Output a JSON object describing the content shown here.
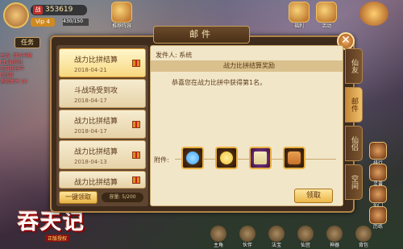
{
  "hud": {
    "power_label": "战",
    "power": "353619",
    "vip": "Vip 4",
    "exp": "430/150",
    "top_icons": [
      "推荐阵容",
      "福利",
      "活动"
    ],
    "quest_btn": "任务",
    "quest_lines": [
      "主线: 拜访神秘",
      "[主线]前往",
      "在百花谷中",
      "[完成]",
      "消耗体力 10"
    ],
    "logo_main": "吞天记",
    "logo_sub": "正版授权"
  },
  "bottom_bar": [
    "主角",
    "伙伴",
    "法宝",
    "仙宫",
    "神器",
    "背包"
  ],
  "side_menu": [
    "排行",
    "灵兽",
    "仙门",
    "历练"
  ],
  "mail": {
    "title": "邮件",
    "close_icon": "close-icon",
    "list": [
      {
        "title": "战力比拼结算",
        "date": "2018-04-21",
        "gift": true,
        "active": true
      },
      {
        "title": "斗战场受到攻",
        "date": "2018-04-17",
        "gift": false,
        "active": false
      },
      {
        "title": "战力比拼结算",
        "date": "2018-04-17",
        "gift": true,
        "active": false
      },
      {
        "title": "战力比拼结算",
        "date": "2018-04-13",
        "gift": true,
        "active": false
      },
      {
        "title": "战力比拼结算",
        "date": "2018-04-",
        "gift": true,
        "active": false
      }
    ],
    "one_key_receive": "一键领取",
    "capacity": "容量: 5/200",
    "sender": "发件人: 系统",
    "subject": "战力比拼结算奖励",
    "body": "恭喜您在战力比拼中获得第1名。",
    "attachments_label": "附件:",
    "attachments": [
      {
        "icon": "diamond-icon",
        "color": "#3aa0ff"
      },
      {
        "icon": "coin-icon",
        "color": "#f0c030"
      },
      {
        "icon": "scroll-icon",
        "color": "#e0d090"
      },
      {
        "icon": "chest-icon",
        "color": "#c8702a"
      }
    ],
    "receive": "领取",
    "tabs": [
      "仙友",
      "邮件",
      "仙侣",
      "空间"
    ]
  }
}
